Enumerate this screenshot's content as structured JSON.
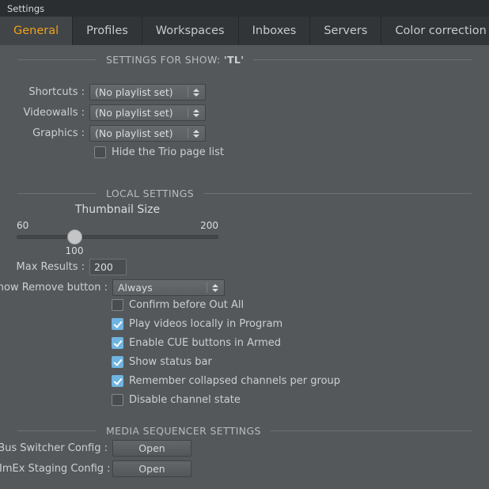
{
  "window": {
    "title": "Settings"
  },
  "tabs": [
    {
      "label": "General",
      "active": true
    },
    {
      "label": "Profiles",
      "active": false
    },
    {
      "label": "Workspaces",
      "active": false
    },
    {
      "label": "Inboxes",
      "active": false
    },
    {
      "label": "Servers",
      "active": false
    },
    {
      "label": "Color correction",
      "active": false
    }
  ],
  "colors": {
    "accent": "#f0a019",
    "panel_bg": "#55585b",
    "chrome_bg": "#2b2e30",
    "checkbox_on": "#6fb4e0"
  },
  "sections": {
    "show": {
      "header_prefix": "SETTINGS FOR SHOW: ",
      "header_value": "'TL'",
      "rows": [
        {
          "label": "Shortcuts :",
          "value": "(No playlist set)"
        },
        {
          "label": "Videowalls :",
          "value": "(No playlist set)"
        },
        {
          "label": "Graphics :",
          "value": "(No playlist set)"
        }
      ],
      "hide_trio": {
        "label": "Hide the Trio page list",
        "checked": false
      }
    },
    "local": {
      "header": "LOCAL SETTINGS",
      "thumbnail": {
        "title": "Thumbnail Size",
        "min": "60",
        "max": "200",
        "value": "100"
      },
      "max_results": {
        "label": "Max Results :",
        "value": "200"
      },
      "show_remove": {
        "label": "Show Remove button :",
        "value": "Always"
      },
      "checkboxes": [
        {
          "label": "Confirm before Out All",
          "checked": false
        },
        {
          "label": "Play videos locally in Program",
          "checked": true
        },
        {
          "label": "Enable CUE buttons in Armed",
          "checked": true
        },
        {
          "label": "Show status bar",
          "checked": true
        },
        {
          "label": "Remember collapsed channels per group",
          "checked": true
        },
        {
          "label": "Disable channel state",
          "checked": false
        }
      ]
    },
    "media_sequencer": {
      "header": "MEDIA SEQUENCER SETTINGS",
      "rows": [
        {
          "label": "PBus Switcher Config :",
          "button": "Open"
        },
        {
          "label": "GH ImEx Staging Config :",
          "button": "Open"
        }
      ]
    }
  }
}
